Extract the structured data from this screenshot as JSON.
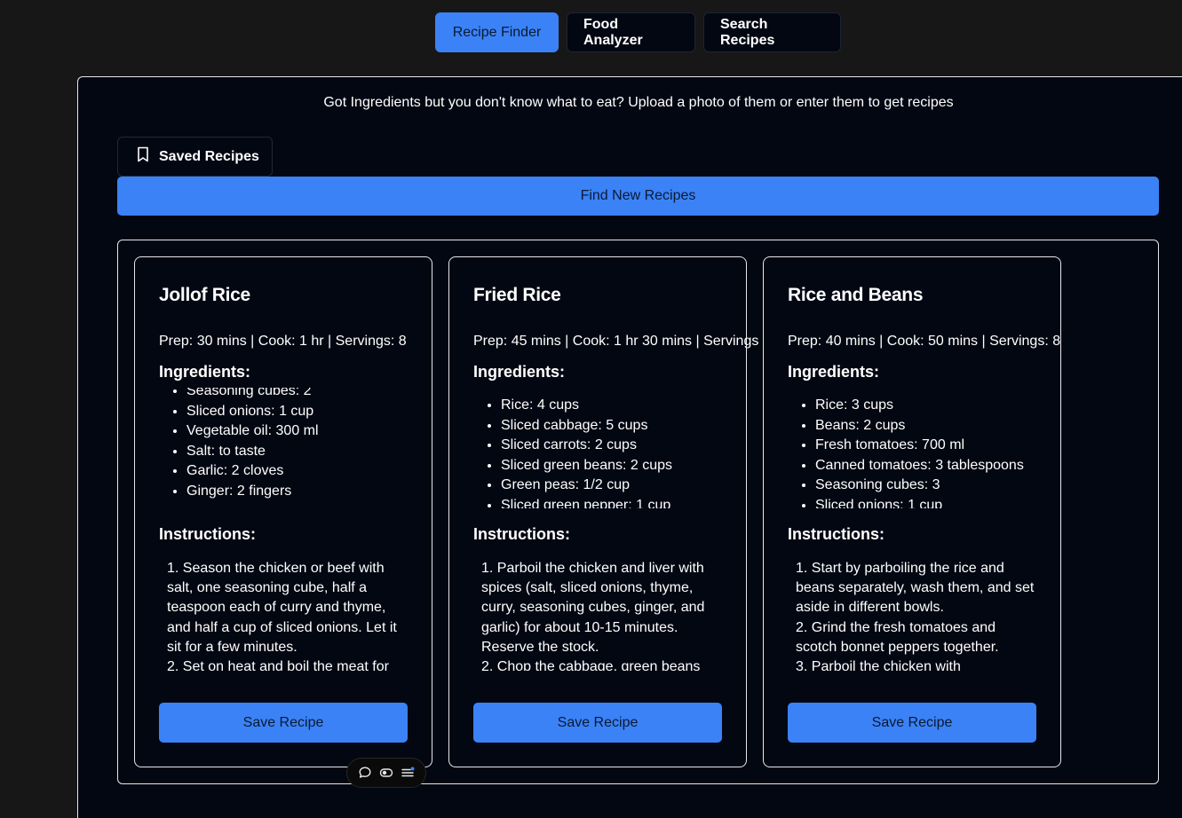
{
  "tabs": [
    {
      "label": "Recipe Finder",
      "active": true
    },
    {
      "label": "Food Analyzer",
      "active": false
    },
    {
      "label": "Search Recipes",
      "active": false
    }
  ],
  "tagline": "Got Ingredients but you don't know what to eat? Upload a photo of them or enter them to get recipes",
  "saved_recipes": {
    "label": "Saved Recipes",
    "icon": "bookmark-icon"
  },
  "find_button": "Find New Recipes",
  "ingredients_heading": "Ingredients:",
  "instructions_heading": "Instructions:",
  "save_label": "Save Recipe",
  "recipes": [
    {
      "title": "Jollof Rice",
      "meta": "Prep: 30 mins | Cook: 1 hr | Servings: 8",
      "ingredients": [
        "Seasoning cubes: 2",
        "Sliced onions: 1 cup",
        "Vegetable oil: 300 ml",
        "Salt: to taste",
        "Garlic: 2 cloves",
        "Ginger: 2 fingers"
      ],
      "instructions": [
        "1. Season the chicken or beef with salt, one seasoning cube, half a teaspoon each of curry and thyme, and half a cup of sliced onions. Let it sit for a few minutes.",
        "2. Set on heat and boil the meat for"
      ]
    },
    {
      "title": "Fried Rice",
      "meta": "Prep: 45 mins | Cook: 1 hr 30 mins | Servings",
      "ingredients": [
        "Rice: 4 cups",
        "Sliced cabbage: 5 cups",
        "Sliced carrots: 2 cups",
        "Sliced green beans: 2 cups",
        "Green peas: 1/2 cup",
        "Sliced green pepper: 1 cup"
      ],
      "instructions": [
        "1. Parboil the chicken and liver with spices (salt, sliced onions, thyme, curry, seasoning cubes, ginger, and garlic) for about 10-15 minutes. Reserve the stock.",
        "2. Chop the cabbage, green beans"
      ]
    },
    {
      "title": "Rice and Beans",
      "meta": "Prep: 40 mins | Cook: 50 mins | Servings: 8",
      "ingredients": [
        "Rice: 3 cups",
        "Beans: 2 cups",
        "Fresh tomatoes: 700 ml",
        "Canned tomatoes: 3 tablespoons",
        "Seasoning cubes: 3",
        "Sliced onions: 1 cup"
      ],
      "instructions": [
        "1. Start by parboiling the rice and beans separately, wash them, and set aside in different bowls.",
        "2. Grind the fresh tomatoes and scotch bonnet peppers together.",
        "3. Parboil the chicken with"
      ]
    }
  ],
  "floating_toolbar": [
    "comment-icon",
    "toggle-icon",
    "menu-icon"
  ],
  "colors": {
    "accent": "#3b82f6",
    "panel": "#030712",
    "background": "#171717"
  }
}
